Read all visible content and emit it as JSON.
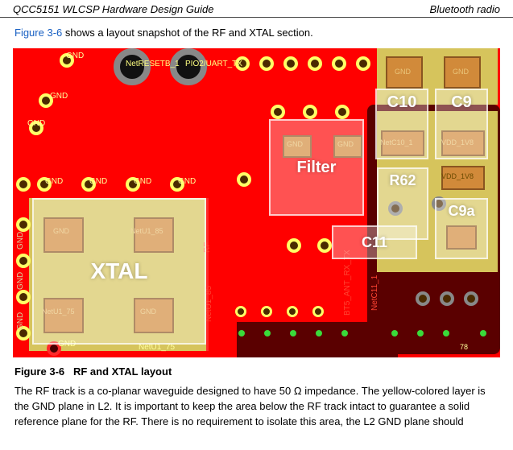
{
  "header": {
    "left": "QCC5151 WLCSP Hardware Design Guide",
    "right": "Bluetooth radio"
  },
  "intro": {
    "link": "Figure 3-6",
    "rest": " shows a layout snapshot of the RF and XTAL section."
  },
  "pcb": {
    "overlays": {
      "xtal": "XTAL",
      "filter": "Filter",
      "c10": "C10",
      "c9": "C9",
      "r62": "R62",
      "c11": "C11",
      "c9a": "C9a"
    },
    "labels": {
      "gnd": "GND",
      "netresetb1": "NetRESETB_1",
      "pio2uarttx": "PIO2/UART_TX",
      "netu1_85": "NetU1_85",
      "netu1_75": "NetU1_75",
      "netc10_1": "NetC10_1",
      "netc11_1": "NetC11_1",
      "vdd_1v8": "VDD_1V8",
      "num78": "78",
      "bt5_ant": "BT5_ANT_RX_TX",
      "rf_side": "RF"
    }
  },
  "caption": {
    "fig": "Figure 3-6",
    "title": "RF and XTAL layout"
  },
  "body": "The RF track is a co-planar waveguide designed to have 50 Ω impedance. The yellow-colored layer is the GND plane in L2. It is important to keep the area below the RF track intact to guarantee a solid reference plane for the RF. There is no requirement to isolate this area, the L2 GND plane should"
}
